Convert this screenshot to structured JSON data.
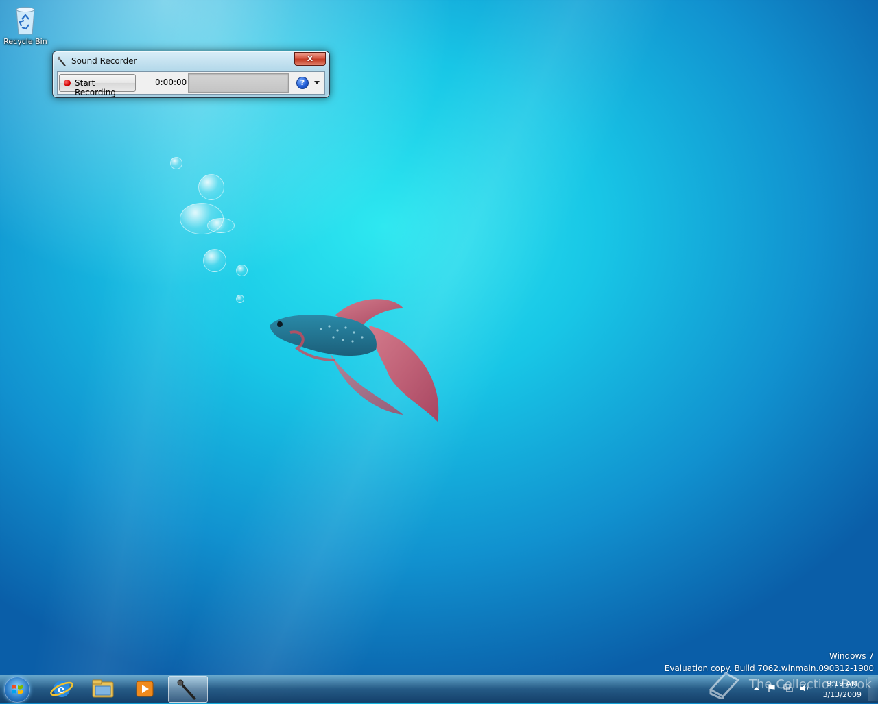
{
  "desktop": {
    "icons": [
      {
        "label": "Recycle Bin",
        "icon": "recycle-bin-icon"
      }
    ],
    "watermark": {
      "line1": "Windows 7",
      "line2": "Evaluation copy. Build 7062.winmain.090312-1900"
    }
  },
  "sound_recorder": {
    "title": "Sound Recorder",
    "close_label": "x",
    "start_label": "Start Recording",
    "time": "0:00:00",
    "help_label": "?"
  },
  "taskbar": {
    "items": [
      {
        "name": "internet-explorer",
        "icon": "ie-icon"
      },
      {
        "name": "windows-explorer",
        "icon": "folder-icon"
      },
      {
        "name": "media-player",
        "icon": "media-player-icon"
      },
      {
        "name": "sound-recorder",
        "icon": "microphone-icon",
        "active": true
      }
    ],
    "clock": {
      "time": "9:19 AM",
      "date": "3/13/2009"
    },
    "overlay_text": "The Collection Book"
  },
  "colors": {
    "record": "#d00000",
    "accent": "#2a79c5"
  }
}
